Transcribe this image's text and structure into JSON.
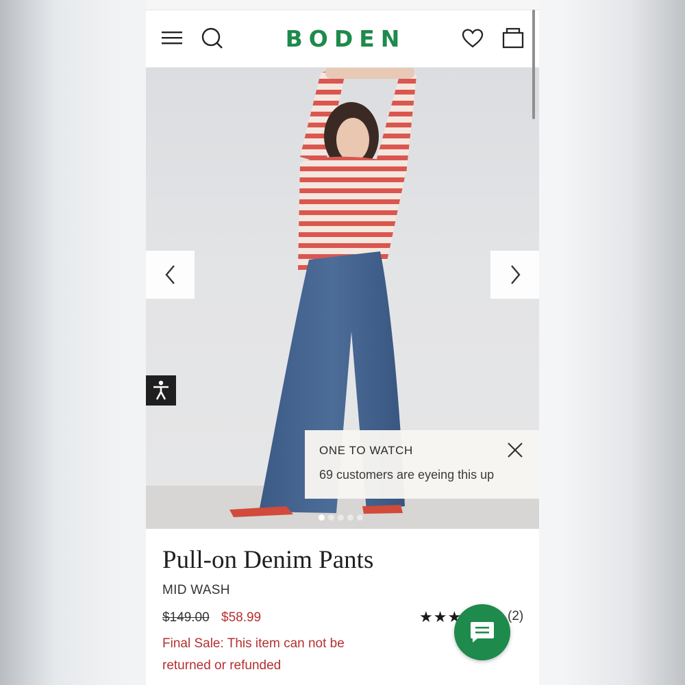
{
  "header": {
    "brand": "BODEN",
    "menu_icon": "hamburger-menu-icon",
    "search_icon": "search-icon",
    "wishlist_icon": "heart-icon",
    "bag_icon": "shopping-bag-icon",
    "brand_color": "#1e8a4c"
  },
  "gallery": {
    "prev_icon": "chevron-left-icon",
    "next_icon": "chevron-right-icon",
    "slide_count": 5,
    "active_slide": 1
  },
  "accessibility": {
    "icon": "accessibility-person-icon"
  },
  "notification": {
    "title": "ONE TO WATCH",
    "message": "69 customers are eyeing this up",
    "close_icon": "close-icon"
  },
  "product": {
    "name": "Pull-on Denim Pants",
    "color": "MID WASH",
    "price_original": "$149.00",
    "price_sale": "$58.99",
    "sale_price_color": "#b5302f",
    "rating_stars": "★★★",
    "review_count": "(2)",
    "final_sale_label": "Final Sale:",
    "final_sale_text_1": "This item can not be",
    "final_sale_text_2": "returned or refunded"
  },
  "chat": {
    "icon": "chat-bubble-icon"
  }
}
